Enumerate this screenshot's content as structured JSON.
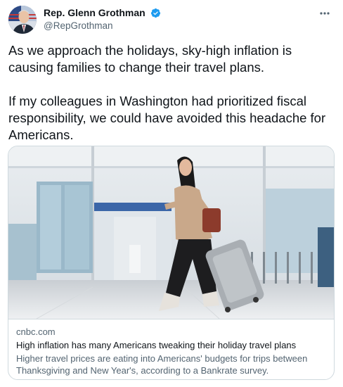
{
  "author": {
    "display_name": "Rep. Glenn Grothman",
    "handle": "@RepGrothman",
    "verified_icon": "verified-badge-icon",
    "avatar_icon": "avatar"
  },
  "tweet": {
    "paragraphs": [
      "As we approach the holidays, sky-high inflation is causing families to change their travel plans.",
      "If my colleagues in Washington had prioritized fiscal responsibility, we could have avoided this headache for Americans."
    ]
  },
  "card": {
    "domain": "cnbc.com",
    "title": "High inflation has many Americans tweaking their holiday travel plans",
    "description": "Higher travel prices are eating into Americans' budgets for trips between Thanksgiving and New Year's, according to a Bankrate survey.",
    "image_icon": "airport-traveler-photo"
  },
  "colors": {
    "text_primary": "#0f1419",
    "text_secondary": "#536471",
    "verified_blue": "#1d9bf0",
    "border": "#cfd9de"
  }
}
